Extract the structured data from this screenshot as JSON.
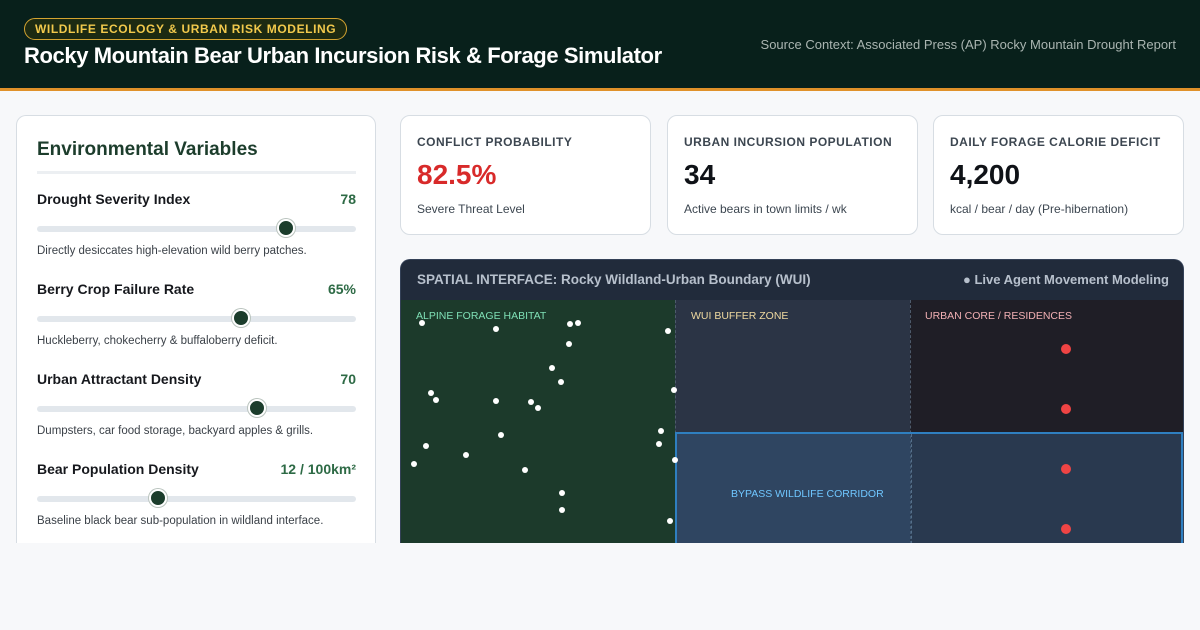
{
  "header": {
    "badge": "WILDLIFE ECOLOGY & URBAN RISK MODELING",
    "title": "Rocky Mountain Bear Urban Incursion Risk & Forage Simulator",
    "source": "Source Context: Associated Press (AP) Rocky Mountain Drought Report"
  },
  "panel": {
    "title": "Environmental Variables",
    "variables": [
      {
        "label": "Drought Severity Index",
        "value": "78",
        "level": 0.78,
        "description": "Directly desiccates high-elevation wild berry patches."
      },
      {
        "label": "Berry Crop Failure Rate",
        "value": "65%",
        "level": 0.64,
        "description": "Huckleberry, chokecherry & buffaloberry deficit."
      },
      {
        "label": "Urban Attractant Density",
        "value": "70",
        "level": 0.69,
        "description": "Dumpsters, car food storage, backyard apples & grills."
      },
      {
        "label": "Bear Population Density",
        "value": "12 / 100km²",
        "level": 0.38,
        "description": "Baseline black bear sub-population in wildland interface."
      }
    ]
  },
  "metrics": [
    {
      "label": "CONFLICT PROBABILITY",
      "value": "82.5%",
      "sub": "Severe Threat Level"
    },
    {
      "label": "URBAN INCURSION POPULATION",
      "value": "34",
      "sub": "Active bears in town limits / wk"
    },
    {
      "label": "DAILY FORAGE CALORIE DEFICIT",
      "value": "4,200",
      "sub": "kcal / bear / day (Pre-hibernation)"
    }
  ],
  "map": {
    "title": "SPATIAL INTERFACE: Rocky Wildland-Urban Boundary (WUI)",
    "status": "● Live Agent Movement Modeling",
    "zones": {
      "habitat": "ALPINE FORAGE HABITAT",
      "buffer": "WUI BUFFER ZONE",
      "urban": "URBAN CORE / RESIDENCES",
      "corridor": "BYPASS WILDLIFE CORRIDOR"
    }
  },
  "colors": {
    "header_bg": "#08201b",
    "accent": "#e0912a",
    "badge_text": "#f2c94c",
    "forest_green": "#1c3d2c",
    "value_green": "#2d6a45",
    "alert_red": "#d82a2a",
    "incident_red": "#ef4444",
    "habitat": "#1c3a2b",
    "buffer": "#2b3445",
    "urban": "#1f1e26",
    "corridor_border": "#2f7fc0"
  }
}
